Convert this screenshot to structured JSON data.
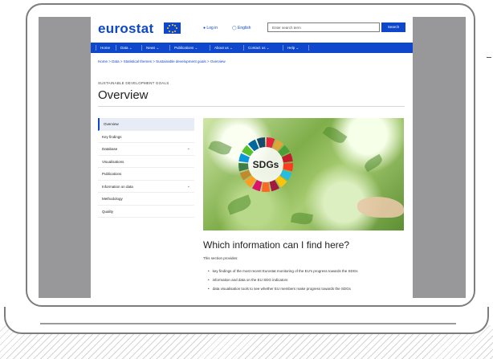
{
  "header": {
    "logo_text": "eurostat",
    "login_label": "Log in",
    "language_label": "English",
    "search_placeholder": "Enter search term",
    "search_button_label": "Search"
  },
  "nav": {
    "items": [
      "Home",
      "Data",
      "News",
      "Publications",
      "About us",
      "Contact us",
      "Help"
    ]
  },
  "breadcrumb": {
    "text": "Home  >  Data  >  Statistical themes  >  Sustainable development goals  >  Overview"
  },
  "page": {
    "kicker": "SUSTAINABLE DEVELOPMENT GOALS",
    "title": "Overview"
  },
  "sidebar": {
    "items": [
      {
        "label": "Overview",
        "active": true
      },
      {
        "label": "Key findings"
      },
      {
        "label": "Database",
        "expandable": true
      },
      {
        "label": "Visualisations"
      },
      {
        "label": "Publications"
      },
      {
        "label": "Information on data",
        "expandable": true
      },
      {
        "label": "Methodology"
      },
      {
        "label": "Quality"
      }
    ]
  },
  "hero": {
    "logo_text": "SDGs",
    "wheel_colors": [
      "#e5243b",
      "#dda63a",
      "#4c9f38",
      "#c5192d",
      "#ff3a21",
      "#26bde2",
      "#fcc30b",
      "#a21942",
      "#fd6925",
      "#dd1367",
      "#fd9d24",
      "#bf8b2e",
      "#3f7e44",
      "#0a97d9",
      "#56c02b",
      "#00689d",
      "#19486a"
    ]
  },
  "content": {
    "heading": "Which information can I find here?",
    "intro": "This section provides:",
    "bullets": [
      "key findings of the most recent Eurostat monitoring of the EU's progress towards the SDGs",
      "information and data on the EU SDG indicators",
      "data visualisation tools to see whether EU members make progress towards the SDGs"
    ]
  },
  "colors": {
    "brand_blue": "#0e47cb",
    "screen_bezel": "#98989a"
  }
}
